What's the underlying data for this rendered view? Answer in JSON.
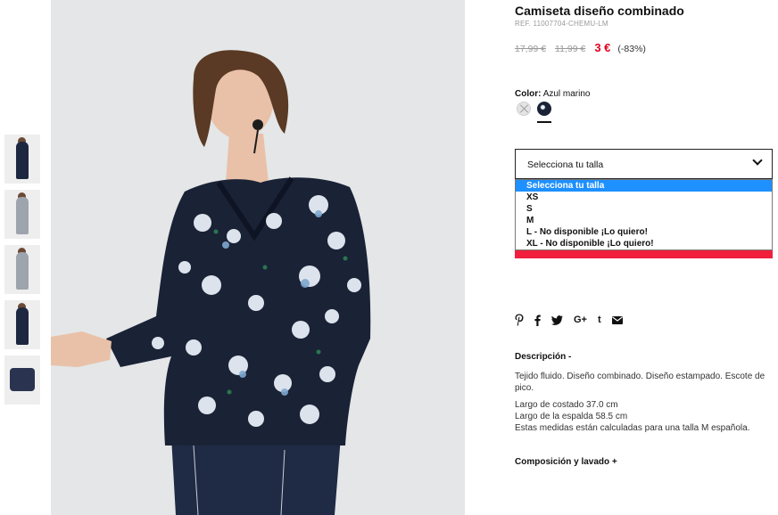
{
  "product": {
    "title": "Camiseta diseño combinado",
    "ref": "REF. 11007704-CHEMU-LM",
    "old_price_1": "17,99 €",
    "old_price_2": "11,99 €",
    "price": "3 €",
    "discount": "(-83%)"
  },
  "color": {
    "label": "Color:",
    "value": "Azul marino"
  },
  "size": {
    "select_label": "Selecciona tu talla",
    "options": [
      "Selecciona tu talla",
      "XS",
      "S",
      "M",
      "L - No disponible ¡Lo quiero!",
      "XL - No disponible ¡Lo quiero!"
    ]
  },
  "social": [
    "pinterest-icon",
    "facebook-icon",
    "twitter-icon",
    "google-plus-icon",
    "tumblr-icon",
    "mail-icon"
  ],
  "social_text": {
    "gplus": "G+",
    "tumblr": "t"
  },
  "description": {
    "title": "Descripción -",
    "p1": "Tejido fluido. Diseño combinado. Diseño estampado. Escote de pico.",
    "line1": "Largo de costado 37.0 cm",
    "line2": "Largo de la espalda 58.5 cm",
    "line3": "Estas medidas están calculadas para una talla M española."
  },
  "composition": {
    "title": "Composición y lavado +"
  },
  "colors": {
    "price_red": "#e3001b",
    "selected_blue": "#1e90ff",
    "alert_red": "#f0203c",
    "shirt_navy": "#1a2236"
  }
}
